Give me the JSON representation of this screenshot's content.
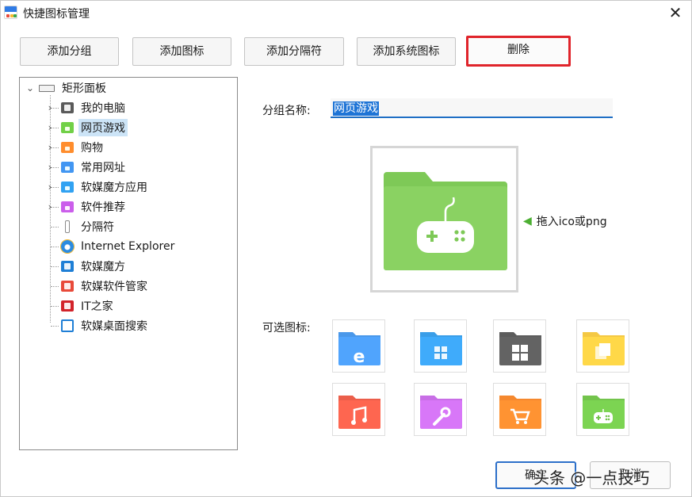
{
  "window": {
    "title": "快捷图标管理",
    "close_glyph": "✕"
  },
  "toolbar": {
    "add_group": "添加分组",
    "add_icon": "添加图标",
    "add_separator": "添加分隔符",
    "add_system_icon": "添加系统图标",
    "delete": "删除"
  },
  "tree": {
    "root": "矩形面板",
    "items": [
      {
        "label": "我的电脑",
        "icon": "computer-icon",
        "color": "#5a5a5a",
        "expandable": true
      },
      {
        "label": "网页游戏",
        "icon": "gamepad-folder-icon",
        "color": "#6cc644",
        "expandable": true,
        "selected": true
      },
      {
        "label": "购物",
        "icon": "cart-folder-icon",
        "color": "#f5862b",
        "expandable": true
      },
      {
        "label": "常用网址",
        "icon": "ie-folder-icon",
        "color": "#3f8fe6",
        "expandable": true
      },
      {
        "label": "软媒魔方应用",
        "icon": "cube-folder-icon",
        "color": "#2f9ae6",
        "expandable": true
      },
      {
        "label": "软件推荐",
        "icon": "wrench-folder-icon",
        "color": "#c15ae0",
        "expandable": true
      },
      {
        "label": "分隔符",
        "icon": "separator-icon",
        "color": "#8a8a8a",
        "expandable": false
      },
      {
        "label": "Internet Explorer",
        "icon": "internet-explorer-icon",
        "color": "#2b8be0",
        "expandable": false
      },
      {
        "label": "软媒魔方",
        "icon": "ruanmei-cube-icon",
        "color": "#1f7fd6",
        "expandable": false
      },
      {
        "label": "软媒软件管家",
        "icon": "software-manager-icon",
        "color": "#e84a3a",
        "expandable": false
      },
      {
        "label": "IT之家",
        "icon": "ithome-icon",
        "color": "#d2232a",
        "expandable": false
      },
      {
        "label": "软媒桌面搜索",
        "icon": "desktop-search-icon",
        "color": "#1f7fd6",
        "expandable": false
      }
    ]
  },
  "group_name": {
    "label": "分组名称:",
    "value": "网页游戏"
  },
  "preview": {
    "icon": "gamepad-folder-icon",
    "color": "#7ec957",
    "drop_hint": "拖入ico或png"
  },
  "icon_picker": {
    "label": "可选图标:",
    "tiles": [
      {
        "icon": "ie-folder-icon",
        "color": "#4a98ea"
      },
      {
        "icon": "cube-folder-icon",
        "color": "#3a9ee8"
      },
      {
        "icon": "windows-folder-icon",
        "color": "#5c5c5c"
      },
      {
        "icon": "documents-folder-icon",
        "color": "#f4c843"
      },
      {
        "icon": "music-folder-icon",
        "color": "#eb5e4a"
      },
      {
        "icon": "wrench-folder-icon",
        "color": "#c86ee6"
      },
      {
        "icon": "cart-folder-icon",
        "color": "#f5882e"
      },
      {
        "icon": "gamepad-folder-icon",
        "color": "#73c44c"
      }
    ]
  },
  "footer": {
    "ok": "确定",
    "cancel": "取消",
    "watermark": "头条 @一点技巧"
  }
}
